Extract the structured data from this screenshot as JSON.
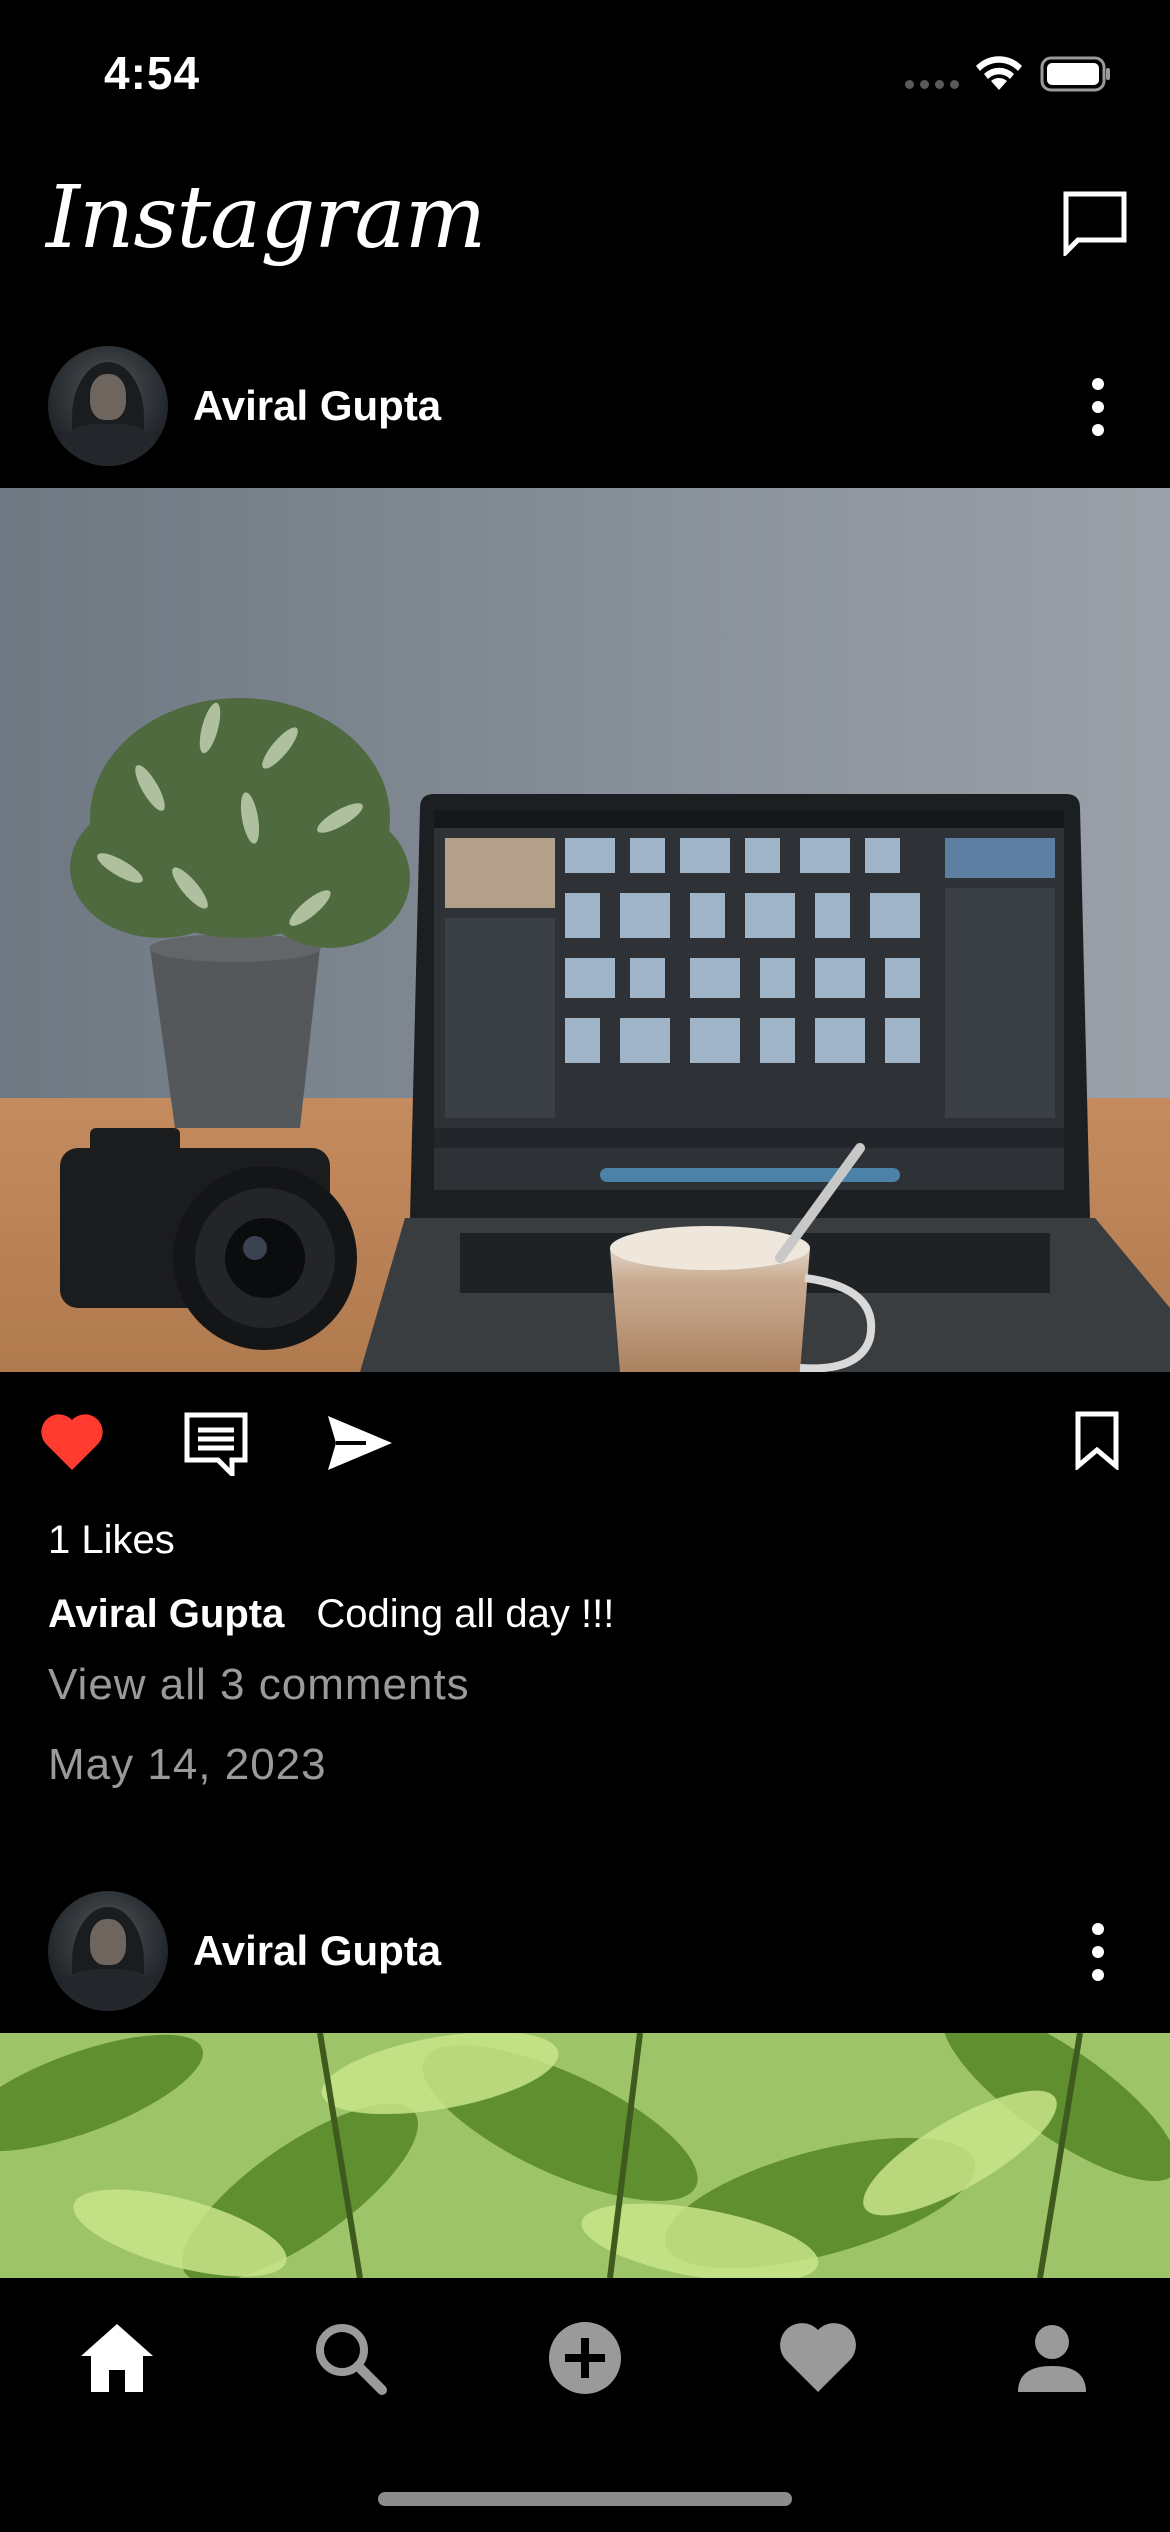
{
  "status_bar": {
    "time": "4:54"
  },
  "header": {
    "logo": "Instagram",
    "messages_icon": "message-square-icon"
  },
  "posts": [
    {
      "user": "Aviral Gupta",
      "more_icon": "more-vertical-icon",
      "photo": "desk with laptop, camera, plant and coffee",
      "liked": true,
      "likes_text": "1 Likes",
      "caption_user": "Aviral Gupta",
      "caption_text": "Coding all day !!!",
      "view_comments": "View all 3 comments",
      "date": "May 14, 2023"
    },
    {
      "user": "Aviral Gupta",
      "more_icon": "more-vertical-icon",
      "photo": "green leaves close-up"
    }
  ],
  "actions": {
    "like_icon": "heart-icon",
    "comment_icon": "comment-icon",
    "share_icon": "send-icon",
    "save_icon": "bookmark-icon",
    "like_color": "#ff3b30"
  },
  "tab_bar": {
    "tabs": [
      "home-icon",
      "search-icon",
      "add-icon",
      "activity-heart-icon",
      "profile-icon"
    ],
    "active": "home-icon"
  }
}
